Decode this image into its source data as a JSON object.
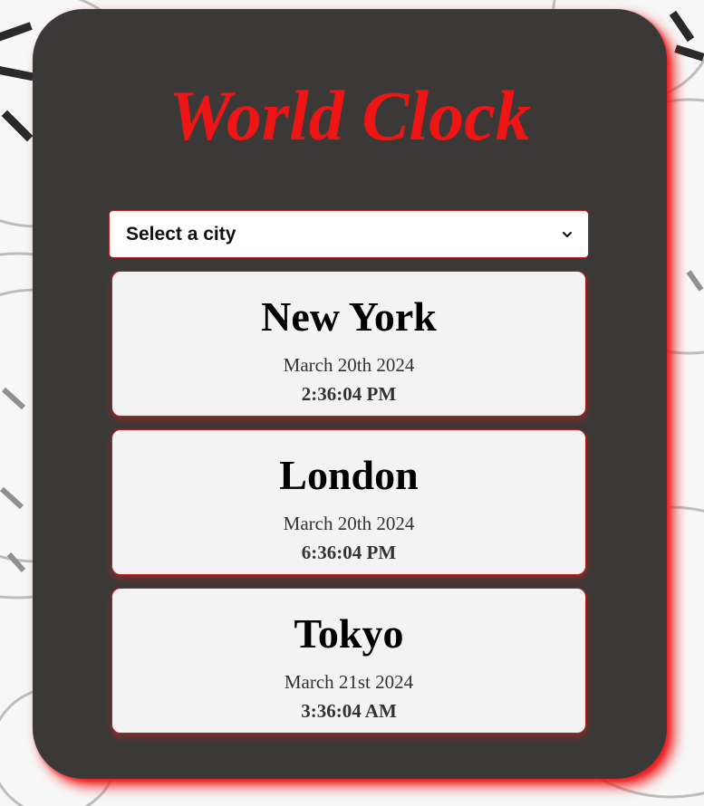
{
  "app": {
    "title": "World Clock",
    "title_color": "#ef1515",
    "panel_color": "#3b3938",
    "accent_glow": "#eb1414"
  },
  "city_select": {
    "selected_label": "Select a city",
    "icon": "chevron-down-icon"
  },
  "cities": [
    {
      "name": "New York",
      "date": "March 20th 2024",
      "time": "2:36:04 PM"
    },
    {
      "name": "London",
      "date": "March 20th 2024",
      "time": "6:36:04 PM"
    },
    {
      "name": "Tokyo",
      "date": "March 21st 2024",
      "time": "3:36:04 AM"
    }
  ],
  "background": {
    "icon": "clock-face-pattern"
  }
}
